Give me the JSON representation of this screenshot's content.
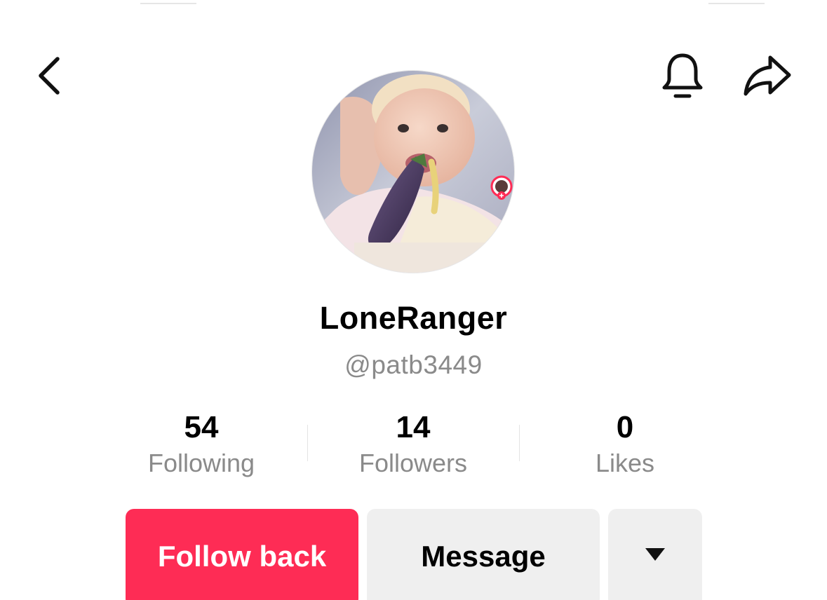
{
  "profile": {
    "display_name": "LoneRanger",
    "username": "@patb3449"
  },
  "stats": [
    {
      "value": "54",
      "label": "Following"
    },
    {
      "value": "14",
      "label": "Followers"
    },
    {
      "value": "0",
      "label": "Likes"
    }
  ],
  "actions": {
    "follow_back_label": "Follow back",
    "message_label": "Message"
  },
  "icons": {
    "back": "chevron-left-icon",
    "notifications": "bell-icon",
    "share": "share-arrow-icon",
    "more": "caret-down-icon",
    "story_badge": "story-ring-icon"
  },
  "colors": {
    "primary_button": "#fe2c55",
    "secondary_button": "#efefef",
    "muted_text": "#8a8a8a",
    "text": "#000000"
  }
}
